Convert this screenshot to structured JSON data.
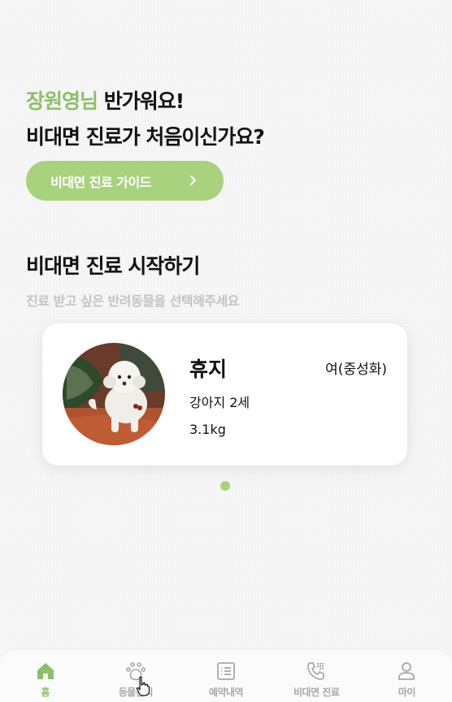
{
  "greeting": {
    "user_name": "장원영님",
    "welcome": " 반가워요!",
    "question": "비대면 진료가 처음이신가요?"
  },
  "guide_button": {
    "label": "비대면 진료 가이드",
    "icon": "chevron-right-icon"
  },
  "start_section": {
    "title": "비대면 진료 시작하기",
    "subtitle": "진료 받고 싶은 반려동물을 선택해주세요"
  },
  "pet": {
    "name": "휴지",
    "sex": "여(중성화)",
    "species_age": "강아지 2세",
    "weight": "3.1kg"
  },
  "pager": {
    "count": 1,
    "active_index": 0
  },
  "tabbar": {
    "active": "홈",
    "items": [
      {
        "label": "홈",
        "icon": "home-icon"
      },
      {
        "label": "동물관리",
        "icon": "paw-icon"
      },
      {
        "label": "예약내역",
        "icon": "list-icon"
      },
      {
        "label": "비대면 진료",
        "icon": "phone-dialpad-icon"
      },
      {
        "label": "마이",
        "icon": "person-icon"
      }
    ]
  },
  "colors": {
    "accent": "#a9d27f",
    "accent_text": "#8cc06a",
    "muted": "#a8a8a8"
  }
}
